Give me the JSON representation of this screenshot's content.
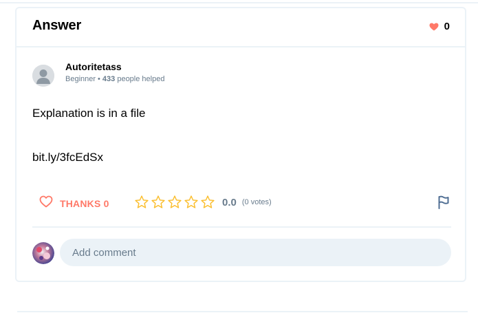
{
  "answer_card": {
    "title": "Answer",
    "likes_count": "0"
  },
  "author": {
    "name": "Autoritetass",
    "rank": "Beginner",
    "separator": "•",
    "helped_count": "433",
    "helped_suffix": "people helped",
    "avatar_icon": "default-user-avatar-icon"
  },
  "answer": {
    "lines": [
      "Explanation is in a file",
      "bit.ly/3fcEdSx"
    ]
  },
  "actions": {
    "thanks_label": "THANKS 0",
    "rating_value": "0.0",
    "rating_votes": "(0 votes)",
    "rating_stars_filled": 0,
    "rating_stars_total": 5,
    "report_icon": "flag-icon"
  },
  "comment": {
    "placeholder": "Add comment"
  },
  "colors": {
    "heart": "#ff7968",
    "thanks": "#ff7968",
    "star_outline": "#fbbe2e",
    "muted_text": "#687b8c",
    "border": "#ebf2f7",
    "input_bg": "#ebf2f7",
    "flag": "#4f6e93"
  }
}
